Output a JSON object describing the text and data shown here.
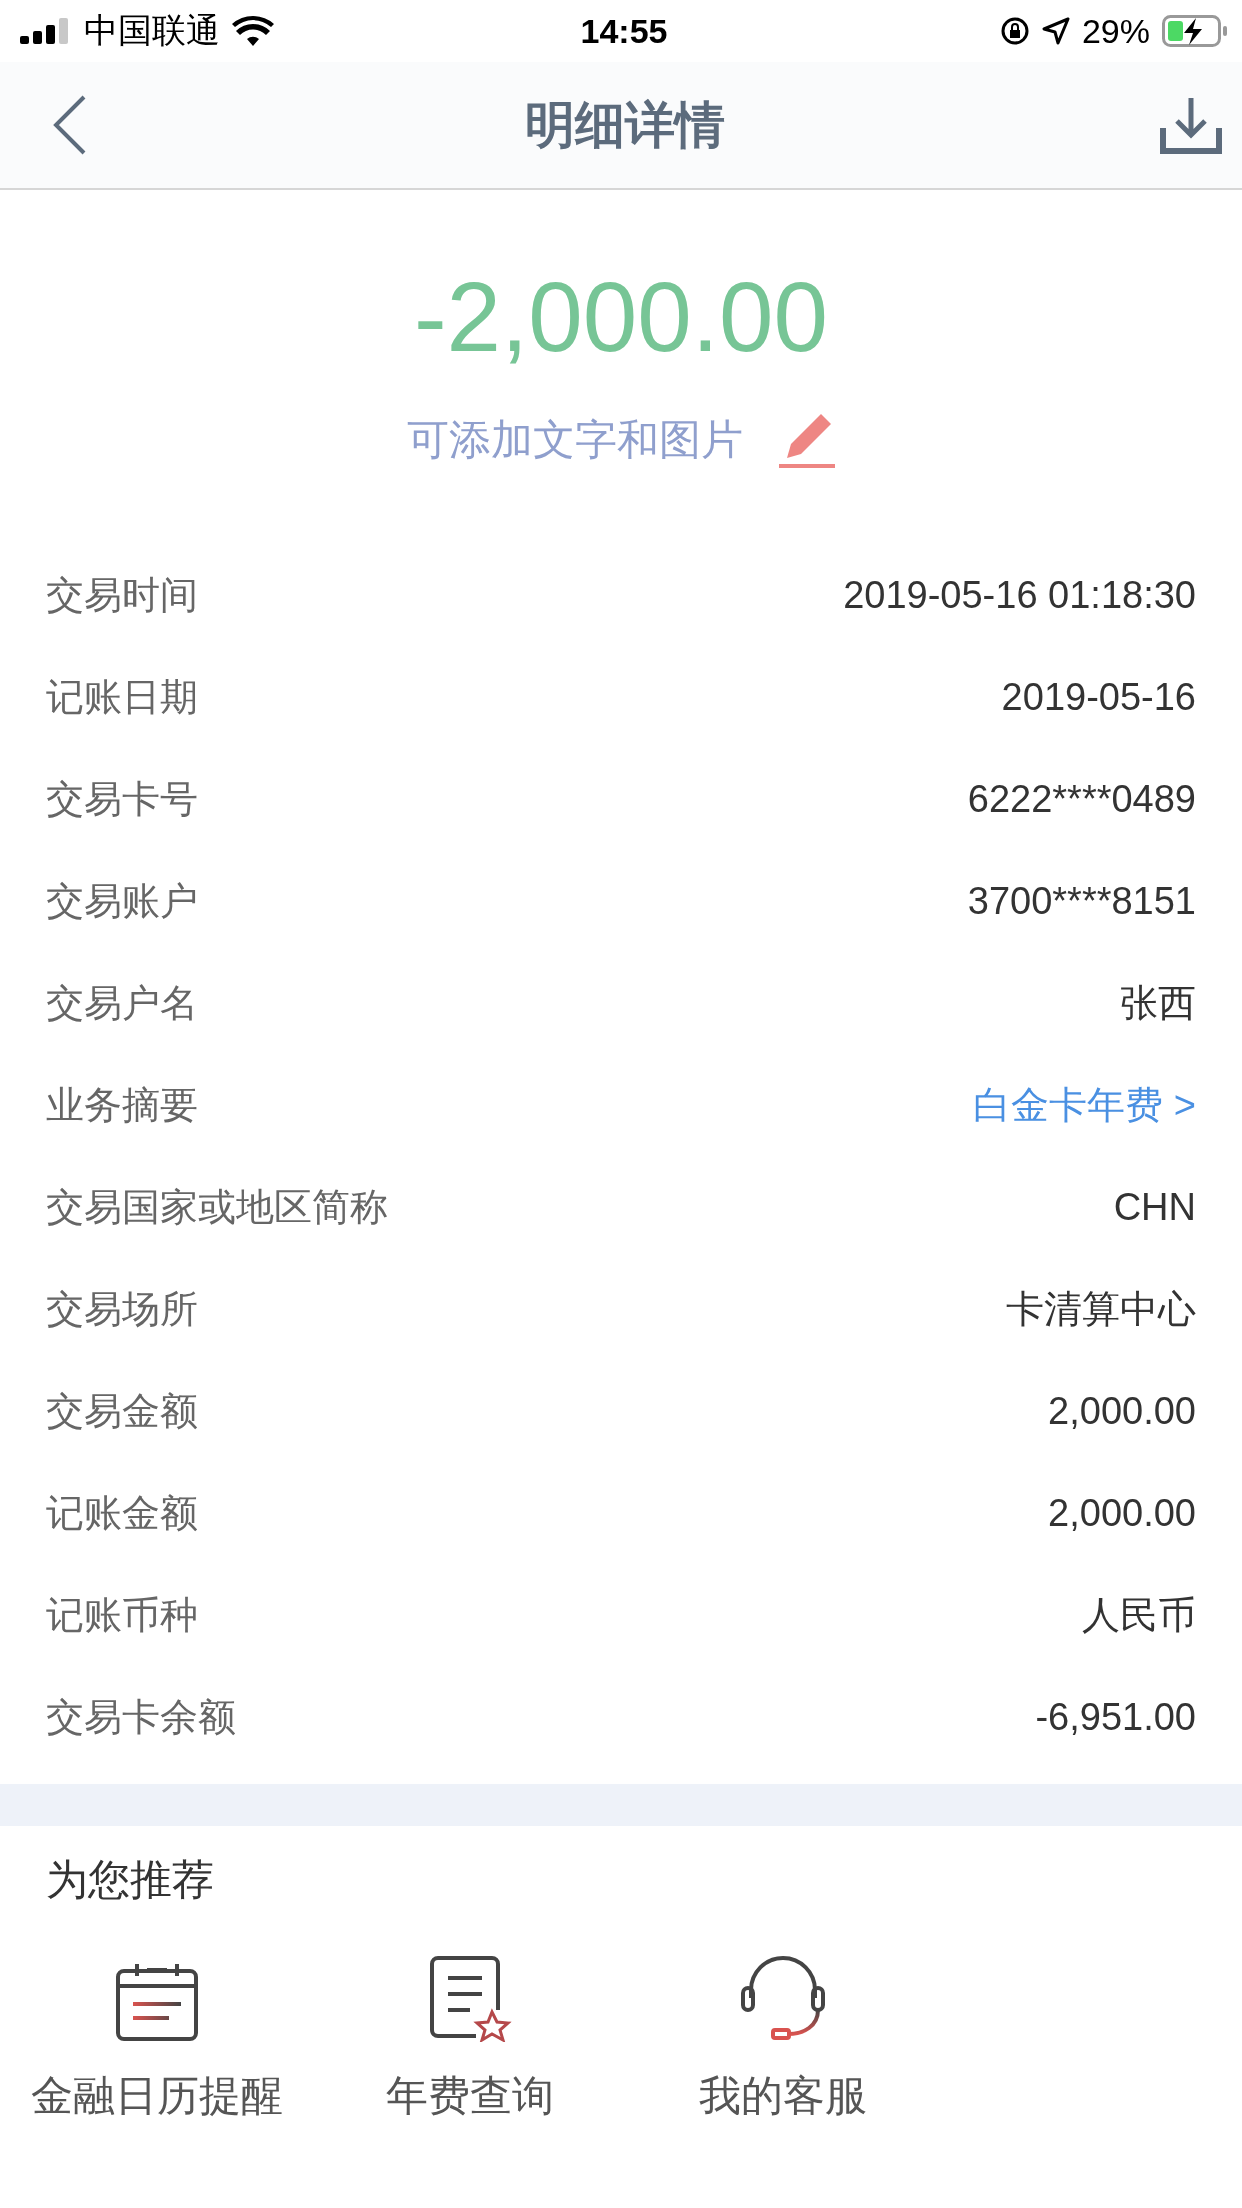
{
  "status_bar": {
    "carrier": "中国联通",
    "time": "14:55",
    "battery_percent": "29%"
  },
  "nav": {
    "title": "明细详情"
  },
  "amount": "-2,000.00",
  "note_prompt": "可添加文字和图片",
  "details": [
    {
      "label": "交易时间",
      "value": "2019-05-16 01:18:30",
      "kind": "text"
    },
    {
      "label": "记账日期",
      "value": "2019-05-16",
      "kind": "text"
    },
    {
      "label": "交易卡号",
      "value": "6222****0489",
      "kind": "text"
    },
    {
      "label": "交易账户",
      "value": "3700****8151",
      "kind": "text"
    },
    {
      "label": "交易户名",
      "value": "张西",
      "kind": "text"
    },
    {
      "label": "业务摘要",
      "value": "白金卡年费 >",
      "kind": "link"
    },
    {
      "label": "交易国家或地区简称",
      "value": "CHN",
      "kind": "text"
    },
    {
      "label": "交易场所",
      "value": "卡清算中心",
      "kind": "text"
    },
    {
      "label": "交易金额",
      "value": "2,000.00",
      "kind": "text"
    },
    {
      "label": "记账金额",
      "value": "2,000.00",
      "kind": "text"
    },
    {
      "label": "记账币种",
      "value": "人民币",
      "kind": "text"
    },
    {
      "label": "交易卡余额",
      "value": "-6,951.00",
      "kind": "text"
    }
  ],
  "recommend": {
    "title": "为您推荐",
    "items": [
      {
        "label": "金融日历提醒",
        "kind": "calendar"
      },
      {
        "label": "年费查询",
        "kind": "document"
      },
      {
        "label": "我的客服",
        "kind": "headset"
      }
    ]
  }
}
